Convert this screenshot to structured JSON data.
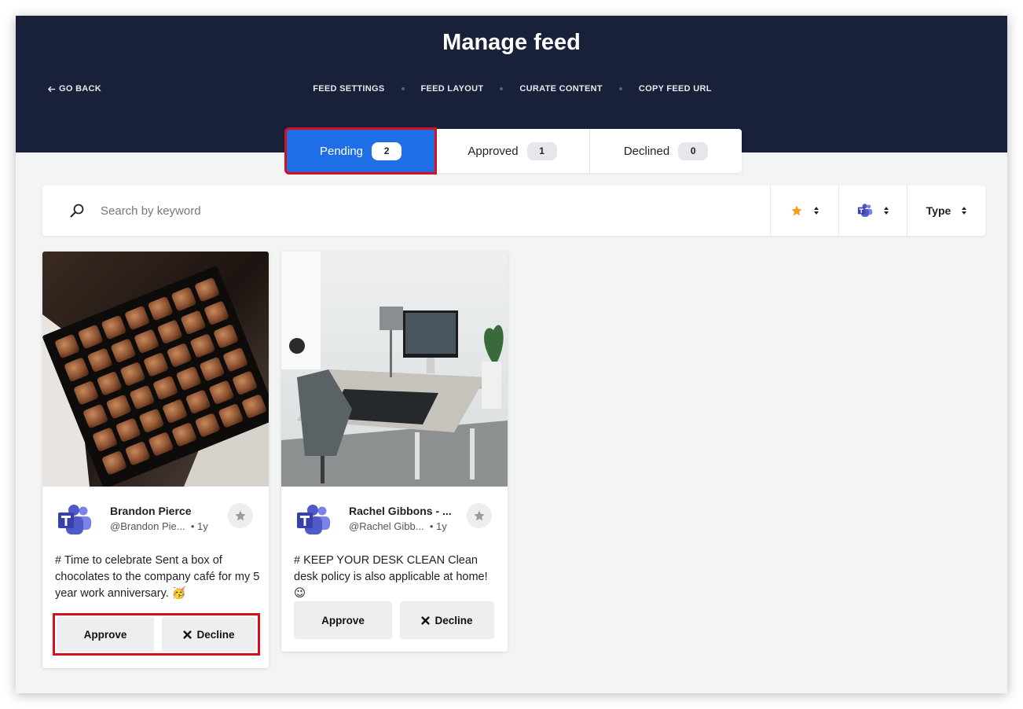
{
  "header": {
    "title": "Manage feed",
    "go_back": "GO BACK",
    "nav": [
      "FEED SETTINGS",
      "FEED LAYOUT",
      "CURATE CONTENT",
      "COPY FEED URL"
    ]
  },
  "tabs": [
    {
      "label": "Pending",
      "count": "2",
      "active": true
    },
    {
      "label": "Approved",
      "count": "1",
      "active": false
    },
    {
      "label": "Declined",
      "count": "0",
      "active": false
    }
  ],
  "search": {
    "placeholder": "Search by keyword",
    "filters": {
      "favorite_icon": "star-icon",
      "source_icon": "teams-icon",
      "type_label": "Type"
    }
  },
  "cards": [
    {
      "image": "box-of-chocolates-photo",
      "author": "Brandon Pierce",
      "handle": "@Brandon Pie...",
      "time": "• 1y",
      "text": "# Time to celebrate Sent a box of chocolates to the company café for my 5 year work anniversary. 🥳",
      "approve": "Approve",
      "decline": "Decline"
    },
    {
      "image": "desk-with-monitor-photo",
      "author": "Rachel Gibbons - ...",
      "handle": "@Rachel Gibb...",
      "time": "• 1y",
      "text": "# KEEP YOUR DESK CLEAN Clean desk policy is also applicable at home! 😉",
      "approve": "Approve",
      "decline": "Decline"
    }
  ],
  "colors": {
    "header_bg": "#18203a",
    "active_tab": "#1e6ee8",
    "highlight": "#d6101d",
    "star": "#f0a020",
    "teams": "#5059c9"
  }
}
